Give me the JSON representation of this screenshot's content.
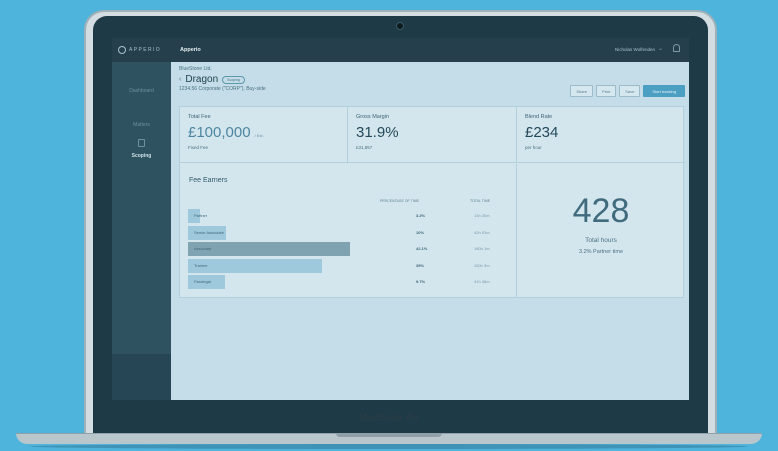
{
  "device": {
    "brand_label": "MacBook Air"
  },
  "topbar": {
    "logo_text": "APPERIO",
    "app_title": "Apperio",
    "user_name": "Nicholas Wolfenden",
    "chevron": "⌄"
  },
  "sidebar": {
    "items": [
      {
        "label": "Dashboard"
      },
      {
        "label": "Matters"
      },
      {
        "label": "Scoping"
      }
    ]
  },
  "header": {
    "client": "BlueStone Ltd.",
    "arrow": "‹",
    "matter_name": "Dragon",
    "status_badge": "Scoping",
    "subtitle": "1234.56 Corporate (\"CORP\"), Buy-side"
  },
  "actions": {
    "share": "Share",
    "print": "Print",
    "save": "Save",
    "start": "Start tracking"
  },
  "cards": {
    "total_fee": {
      "title": "Total Fee",
      "value": "£100,000",
      "unit": "/ Est.",
      "sub": "Fixed Fee"
    },
    "gross_margin": {
      "title": "Gross Margin",
      "value": "31.9%",
      "sub": "£31,857"
    },
    "blend_rate": {
      "title": "Blend Rate",
      "value": "£234",
      "sub": "per hour"
    }
  },
  "fee_earners": {
    "title": "Fee Earners",
    "col_pct": "PERCENTAGE OF TIME",
    "col_total": "TOTAL TIME",
    "rows": [
      {
        "label": "Partner",
        "pct": "3.2%",
        "time": "13h 30m",
        "share": 0.032
      },
      {
        "label": "Senior Associate",
        "pct": "10%",
        "time": "42h 51m",
        "share": 0.1
      },
      {
        "label": "Associate",
        "pct": "42.1%",
        "time": "180h 1m",
        "share": 0.421
      },
      {
        "label": "Trainee",
        "pct": "35%",
        "time": "150h 3m",
        "share": 0.35
      },
      {
        "label": "Paralegal",
        "pct": "9.7%",
        "time": "41h 36m",
        "share": 0.097
      }
    ]
  },
  "totals": {
    "hours": "428",
    "hours_label": "Total hours",
    "partner_label": "3.2% Partner time"
  },
  "colors": {
    "accent": "#4a9fc3",
    "bar_dark": "#7fa3b1",
    "bar_light": "#9ec9dc",
    "page_bg": "#4fb4dc"
  }
}
